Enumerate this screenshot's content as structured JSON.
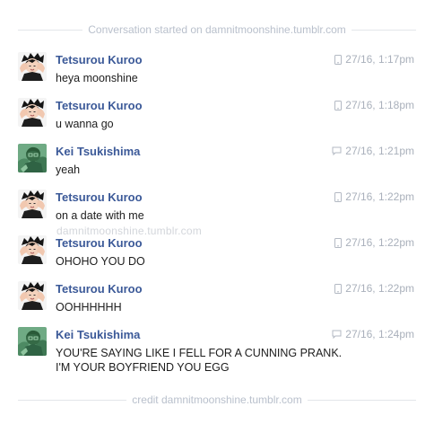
{
  "header": {
    "text": "Conversation started on damnitmoonshine.tumblr.com"
  },
  "footer": {
    "text": "credit damnitmoonshine.tumblr.com"
  },
  "watermark": {
    "text": "damnitmoonshine.tumblr.com"
  },
  "colors": {
    "name": "#3b5998",
    "timestamp": "#a9b0bb",
    "divider_text": "#b9c0cc",
    "message": "#1d1d1d"
  },
  "messages": [
    {
      "sender": "Tetsurou Kuroo",
      "avatar": "kuroo-avatar",
      "device_icon": "mobile-phone-icon",
      "time": "27/16, 1:17pm",
      "lines": [
        "heya moonshine"
      ]
    },
    {
      "sender": "Tetsurou Kuroo",
      "avatar": "kuroo-avatar",
      "device_icon": "mobile-phone-icon",
      "time": "27/16, 1:18pm",
      "lines": [
        "u wanna go"
      ]
    },
    {
      "sender": "Kei Tsukishima",
      "avatar": "tsukishima-avatar",
      "device_icon": "chat-bubble-icon",
      "time": "27/16, 1:21pm",
      "lines": [
        "yeah"
      ]
    },
    {
      "sender": "Tetsurou Kuroo",
      "avatar": "kuroo-avatar",
      "device_icon": "mobile-phone-icon",
      "time": "27/16, 1:22pm",
      "lines": [
        "on a date with me"
      ]
    },
    {
      "sender": "Tetsurou Kuroo",
      "avatar": "kuroo-avatar",
      "device_icon": "mobile-phone-icon",
      "time": "27/16, 1:22pm",
      "lines": [
        "OHOHO YOU DO"
      ]
    },
    {
      "sender": "Tetsurou Kuroo",
      "avatar": "kuroo-avatar",
      "device_icon": "mobile-phone-icon",
      "time": "27/16, 1:22pm",
      "lines": [
        "OOHHHHHH"
      ]
    },
    {
      "sender": "Kei Tsukishima",
      "avatar": "tsukishima-avatar",
      "device_icon": "chat-bubble-icon",
      "time": "27/16, 1:24pm",
      "lines": [
        "YOU'RE SAYING LIKE I FELL FOR A CUNNING PRANK.",
        "I'M YOUR BOYFRIEND YOU EGG"
      ]
    }
  ]
}
